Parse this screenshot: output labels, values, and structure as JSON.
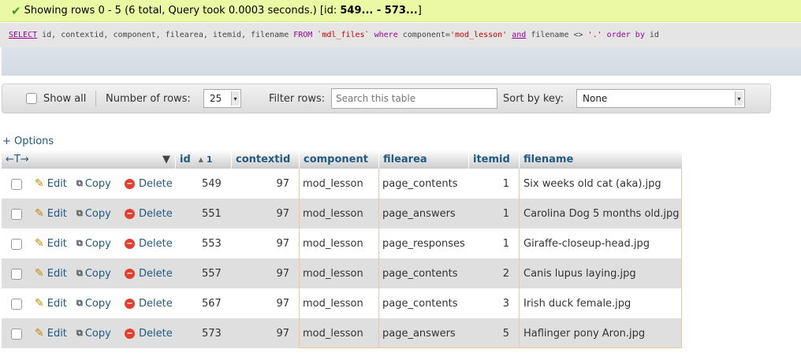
{
  "message": {
    "prefix": "Showing rows 0 - 5 (6 total, Query took 0.0003 seconds.) [id: ",
    "bold": "549... - 573...",
    "suffix": "]"
  },
  "sql": {
    "select": "SELECT",
    "cols": " id, contextid, component, filearea, itemid, filename ",
    "from": "FROM",
    "table": " `mdl_files` ",
    "where": "where",
    "cond1": " component=",
    "val1": "'mod_lesson'",
    "and": "and",
    "cond2": " filename <> ",
    "val2": "'.'",
    "order": "order by",
    "ordcol": " id"
  },
  "toolbar": {
    "show_all": "Show all",
    "rows_label": "Number of rows:",
    "rows_value": "25",
    "filter_label": "Filter rows:",
    "filter_placeholder": "Search this table",
    "sort_label": "Sort by key:",
    "sort_value": "None"
  },
  "options_link": "+ Options",
  "table": {
    "nav_arrows": "←T→",
    "headers": {
      "id": "id",
      "id_sort": "1",
      "contextid": "contextid",
      "component": "component",
      "filearea": "filearea",
      "itemid": "itemid",
      "filename": "filename"
    },
    "actions": {
      "edit": "Edit",
      "copy": "Copy",
      "delete": "Delete"
    },
    "rows": [
      {
        "id": "549",
        "contextid": "97",
        "component": "mod_lesson",
        "filearea": "page_contents",
        "itemid": "1",
        "filename": "Six weeks old cat (aka).jpg"
      },
      {
        "id": "551",
        "contextid": "97",
        "component": "mod_lesson",
        "filearea": "page_answers",
        "itemid": "1",
        "filename": "Carolina Dog 5 months old.jpg"
      },
      {
        "id": "553",
        "contextid": "97",
        "component": "mod_lesson",
        "filearea": "page_responses",
        "itemid": "1",
        "filename": "Giraffe-closeup-head.jpg"
      },
      {
        "id": "557",
        "contextid": "97",
        "component": "mod_lesson",
        "filearea": "page_contents",
        "itemid": "2",
        "filename": "Canis lupus laying.jpg"
      },
      {
        "id": "567",
        "contextid": "97",
        "component": "mod_lesson",
        "filearea": "page_contents",
        "itemid": "3",
        "filename": "Irish duck female.jpg"
      },
      {
        "id": "573",
        "contextid": "97",
        "component": "mod_lesson",
        "filearea": "page_answers",
        "itemid": "5",
        "filename": "Haflinger pony Aron.jpg"
      }
    ]
  },
  "colors": {
    "link": "#235a81",
    "success_bg": "#ebf8a4",
    "keyword": "#990099",
    "string": "#cc0000"
  }
}
